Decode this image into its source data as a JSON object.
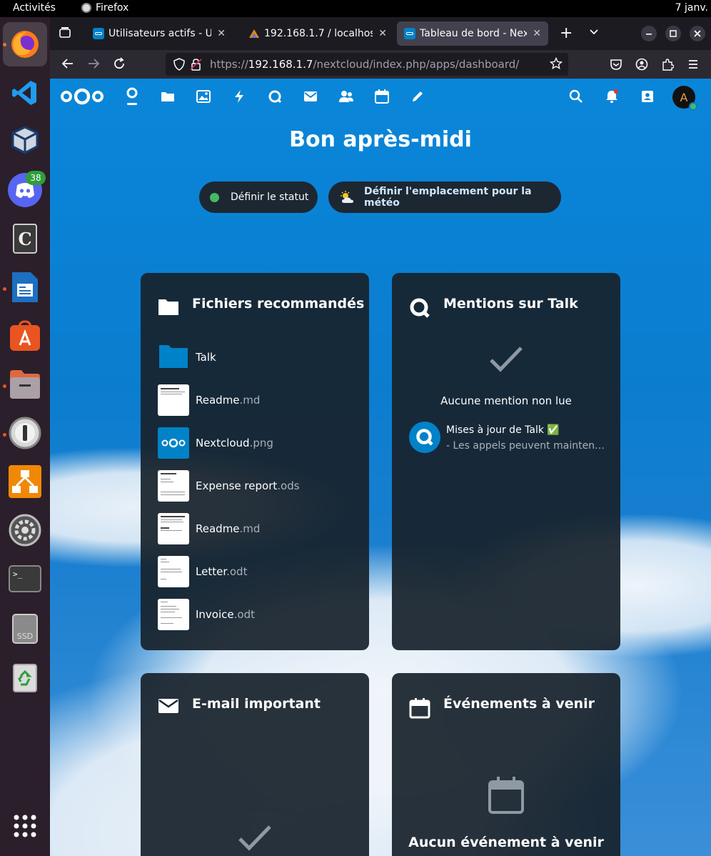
{
  "topbar": {
    "activities": "Activités",
    "app_name": "Firefox",
    "clock": "7 janv."
  },
  "dock": {
    "discord_badge": "38"
  },
  "browser": {
    "tabs": [
      {
        "label": "Utilisateurs actifs - Utili"
      },
      {
        "label": "192.168.1.7 / localhost |"
      },
      {
        "label": "Tableau de bord - Next"
      }
    ],
    "url_prefix": "https://",
    "url_host": "192.168.1.7",
    "url_path": "/nextcloud/index.php/apps/dashboard/"
  },
  "nextcloud": {
    "greeting": "Bon après-midi",
    "status_button": "Définir le statut",
    "weather_button": "Définir l'emplacement pour la météo",
    "avatar_initial": "A",
    "panels": {
      "files": {
        "title": "Fichiers recommandés",
        "items": [
          {
            "name": "Talk",
            "ext": ""
          },
          {
            "name": "Readme",
            "ext": ".md"
          },
          {
            "name": "Nextcloud",
            "ext": ".png"
          },
          {
            "name": "Expense report",
            "ext": ".ods"
          },
          {
            "name": "Readme",
            "ext": ".md"
          },
          {
            "name": "Letter",
            "ext": ".odt"
          },
          {
            "name": "Invoice",
            "ext": ".odt"
          }
        ]
      },
      "talk": {
        "title": "Mentions sur Talk",
        "empty": "Aucune mention non lue",
        "mention_title": "Mises à jour de Talk ✅",
        "mention_sub": "- Les appels peuvent mainten…"
      },
      "mail": {
        "title": "E-mail important"
      },
      "events": {
        "title": "Événements à venir",
        "empty": "Aucun événement à venir"
      }
    }
  }
}
